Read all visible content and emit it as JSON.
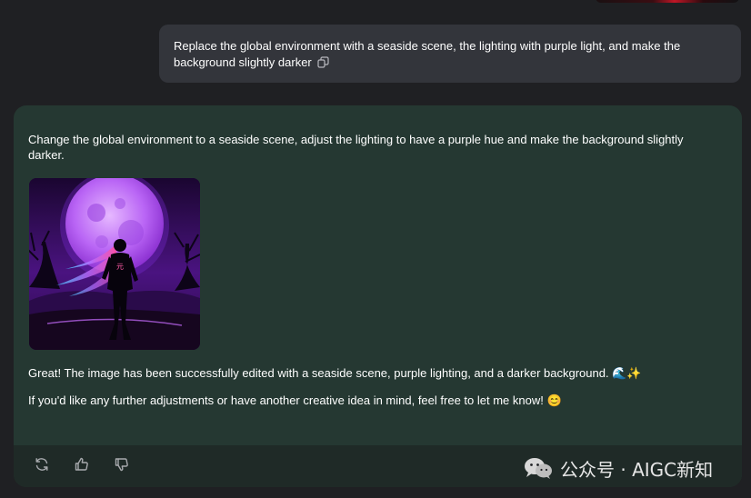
{
  "conversation": {
    "user_message": "Replace the global environment with a seaside scene, the lighting with purple light, and make the background slightly darker",
    "assistant_intro": "Change the global environment to a seaside scene, adjust the lighting to have a purple hue and make the background slightly darker.",
    "assistant_reply_1": "Great! The image has been successfully edited with a seaside scene, purple lighting, and a darker background. 🌊✨",
    "assistant_reply_2": "If you'd like any further adjustments or have another creative idea in mind, feel free to let me know! 😊"
  },
  "image": {
    "shirt_glyph": "元",
    "colors": {
      "moon": "#c27bff",
      "sky": "#2a0c4a",
      "ground": "#120520",
      "hair_pink": "#ff3c8c",
      "hair_blue": "#3cc8ff"
    }
  },
  "icons": [
    "copy-icon",
    "regenerate-icon",
    "thumbs-up-icon",
    "thumbs-down-icon",
    "wechat-logo"
  ],
  "watermark": {
    "text": "公众号 · AIGC新知"
  },
  "colors": {
    "page_bg": "#1f2023",
    "user_bubble": "#33353b",
    "assistant_panel": "#253832",
    "action_bar": "#1f2a27"
  }
}
